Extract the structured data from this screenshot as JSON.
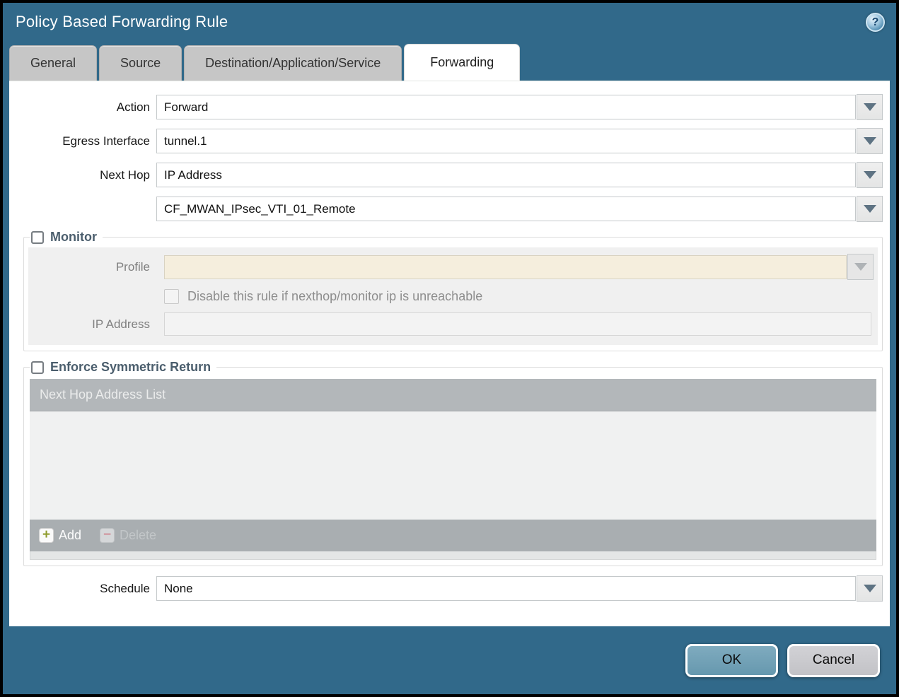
{
  "window": {
    "title": "Policy Based Forwarding Rule",
    "help_icon_glyph": "?"
  },
  "tabs": [
    {
      "label": "General",
      "active": false
    },
    {
      "label": "Source",
      "active": false
    },
    {
      "label": "Destination/Application/Service",
      "active": false
    },
    {
      "label": "Forwarding",
      "active": true
    }
  ],
  "form": {
    "action_label": "Action",
    "action_value": "Forward",
    "egress_interface_label": "Egress Interface",
    "egress_interface_value": "tunnel.1",
    "next_hop_label": "Next Hop",
    "next_hop_value": "IP Address",
    "next_hop_address_value": "CF_MWAN_IPsec_VTI_01_Remote",
    "schedule_label": "Schedule",
    "schedule_value": "None"
  },
  "monitor": {
    "legend": "Monitor",
    "checked": false,
    "profile_label": "Profile",
    "profile_value": "",
    "disable_rule_label": "Disable this rule if nexthop/monitor ip is unreachable",
    "disable_rule_checked": false,
    "ip_address_label": "IP Address",
    "ip_address_value": ""
  },
  "enforce_symmetric_return": {
    "legend": "Enforce Symmetric Return",
    "checked": false,
    "list_header": "Next Hop Address List",
    "rows": [],
    "add_label": "Add",
    "add_icon_glyph": "+",
    "delete_label": "Delete",
    "delete_icon_glyph": "−",
    "delete_enabled": false
  },
  "footer": {
    "ok_label": "OK",
    "cancel_label": "Cancel"
  },
  "colors": {
    "titlebar_teal": "#31698a",
    "tab_inactive_gray": "#c6c6c6",
    "disabled_profile_field": "#f5eedd",
    "table_header_gray": "#b3b7ba",
    "table_footer_gray": "#a9aeb1",
    "ok_button_blue": "#6fa1b7",
    "cancel_button_gray": "#c9c9cd",
    "add_plus_green": "#8f9c2e",
    "delete_minus_red": "#d0919b"
  }
}
